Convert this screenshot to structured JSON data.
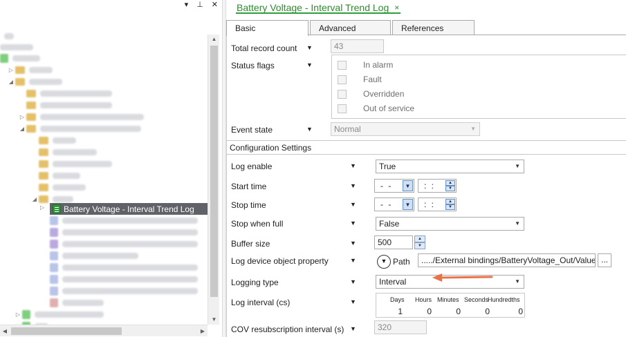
{
  "left_pane": {
    "toolbar": {
      "dropdown_icon": "▾",
      "pin_icon": "📌",
      "close_icon": "✕"
    },
    "selected_item": "Battery Voltage - Interval Trend Log"
  },
  "document_tab": {
    "title": "Battery Voltage - Interval Trend Log",
    "close": "×"
  },
  "tabs": [
    {
      "label": "Basic",
      "active": true
    },
    {
      "label": "Advanced",
      "active": false
    },
    {
      "label": "References",
      "active": false
    }
  ],
  "basic": {
    "total_record_count": {
      "label": "Total record count",
      "value": "43"
    },
    "status_flags": {
      "label": "Status flags",
      "flags": [
        "In alarm",
        "Fault",
        "Overridden",
        "Out of service"
      ]
    },
    "event_state": {
      "label": "Event state",
      "value": "Normal"
    },
    "section_title": "Configuration Settings",
    "log_enable": {
      "label": "Log enable",
      "value": "True"
    },
    "start_time": {
      "label": "Start time",
      "date": "- -",
      "time": ": :"
    },
    "stop_time": {
      "label": "Stop time",
      "date": "- -",
      "time": ": :"
    },
    "stop_when_full": {
      "label": "Stop when full",
      "value": "False"
    },
    "buffer_size": {
      "label": "Buffer size",
      "value": "500"
    },
    "log_device_object_property": {
      "label": "Log device object property",
      "path_label": "Path",
      "path_value": "...../External bindings/BatteryVoltage_Out/Value",
      "browse": "..."
    },
    "logging_type": {
      "label": "Logging type",
      "value": "Interval"
    },
    "log_interval": {
      "label": "Log interval (cs)",
      "headers": [
        "Days",
        "Hours",
        "Minutes",
        "Seconds",
        "Hundredths"
      ],
      "values": [
        "1",
        "0",
        "0",
        "0",
        "0"
      ]
    },
    "cov_resubscription": {
      "label": "COV resubscription interval (s)",
      "value": "320"
    }
  },
  "colors": {
    "accent_green": "#2e8b2e",
    "annotation_arrow": "#e8734a",
    "selection": "#5f6368"
  }
}
